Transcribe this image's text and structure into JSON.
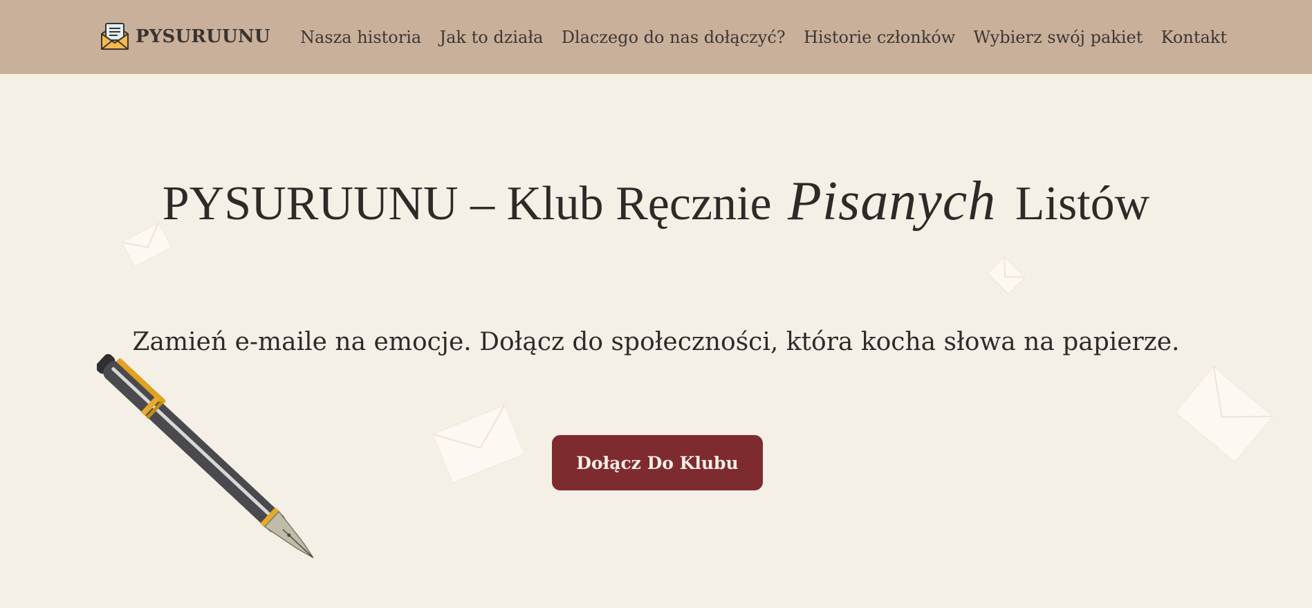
{
  "brand": {
    "name": "PYSURUUNU",
    "icon": "envelope-letter-icon"
  },
  "nav": {
    "items": [
      {
        "label": "Nasza historia"
      },
      {
        "label": "Jak to działa"
      },
      {
        "label": "Dlaczego do nas dołączyć?"
      },
      {
        "label": "Historie członków"
      },
      {
        "label": "Wybierz swój pakiet"
      },
      {
        "label": "Kontakt"
      }
    ]
  },
  "hero": {
    "title_part1": "PYSURUUNU – Klub Ręcznie",
    "title_script": "Pisanych",
    "title_part2": "Listów",
    "subtitle": "Zamień e-maile na emocje. Dołącz do społeczności, która kocha słowa na papierze.",
    "cta_label": "Dołącz Do Klubu"
  },
  "decorations": {
    "pen": "fountain-pen-icon",
    "envelopes": "envelope-icon"
  },
  "colors": {
    "header_bg": "#c9b09a",
    "page_bg": "#f5f0e6",
    "cta_bg": "#7e2b30",
    "cta_text": "#f7efe6",
    "text": "#2f2a28"
  }
}
